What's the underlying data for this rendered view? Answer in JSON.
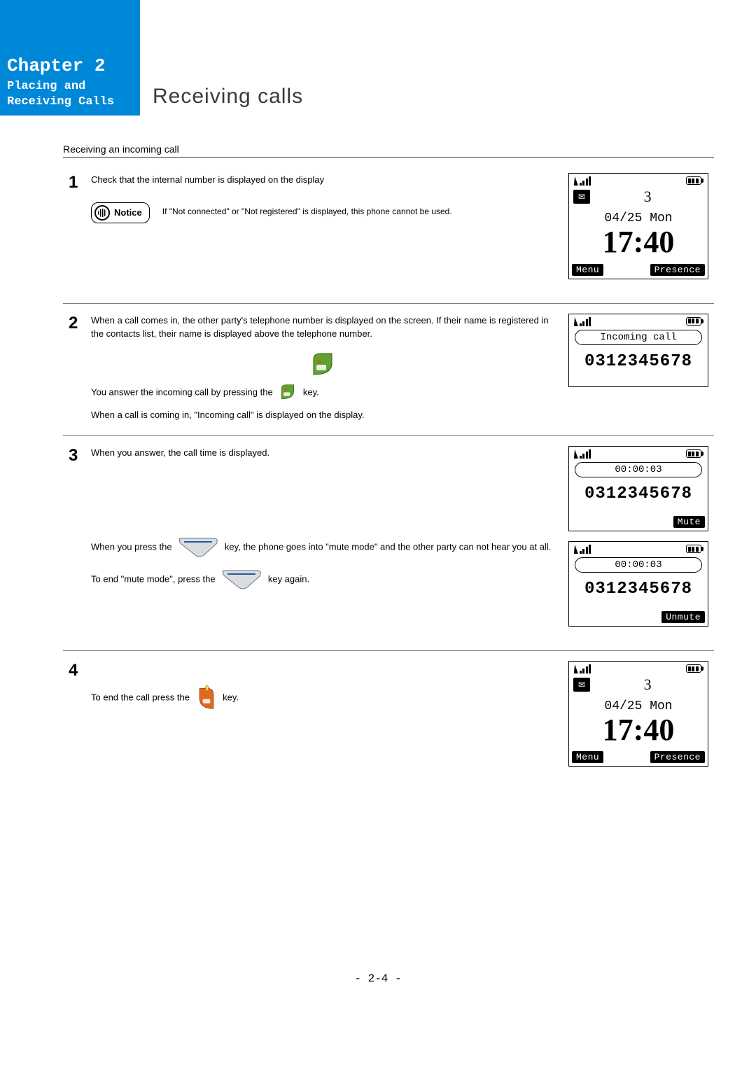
{
  "chapter": {
    "title": "Chapter 2",
    "subtitle1": "Placing and",
    "subtitle2": "Receiving Calls"
  },
  "page_title": "Receiving calls",
  "subheading": "Receiving an incoming call",
  "steps": {
    "s1": {
      "num": "1",
      "text": "Check that the internal number is displayed on the display",
      "notice_label": "Notice",
      "notice_text": "If \"Not connected\" or \"Not registered\" is displayed, this phone cannot be used.",
      "screen": {
        "vm_count": "3",
        "date": "04/25 Mon",
        "clock": "17:40",
        "soft_left": "Menu",
        "soft_right": "Presence"
      }
    },
    "s2": {
      "num": "2",
      "text1": "When a call comes in, the other party's telephone number is displayed on the screen. If their name is registered in the contacts list, their name is displayed above the telephone number.",
      "text2a": "You answer the incoming call by pressing the ",
      "text2b": " key.",
      "text3": "When a call is coming in, \"Incoming call\" is displayed on the display.",
      "screen": {
        "bubble": "Incoming call",
        "number": "0312345678"
      }
    },
    "s3": {
      "num": "3",
      "text1": "When you answer, the call time is displayed.",
      "text2a": "When you press the ",
      "text2b": " key, the phone goes into \"mute mode\" and the other party can not hear you at all.",
      "text3a": "To end \"mute mode\", press the ",
      "text3b": " key again.",
      "screenA": {
        "timer": "00:00:03",
        "number": "0312345678",
        "soft_right": "Mute"
      },
      "screenB": {
        "timer": "00:00:03",
        "number": "0312345678",
        "soft_right": "Unmute"
      }
    },
    "s4": {
      "num": "4",
      "text_a": "To end the call press the ",
      "text_b": " key.",
      "screen": {
        "vm_count": "3",
        "date": "04/25 Mon",
        "clock": "17:40",
        "soft_left": "Menu",
        "soft_right": "Presence"
      }
    }
  },
  "footer": "- 2-4 -"
}
